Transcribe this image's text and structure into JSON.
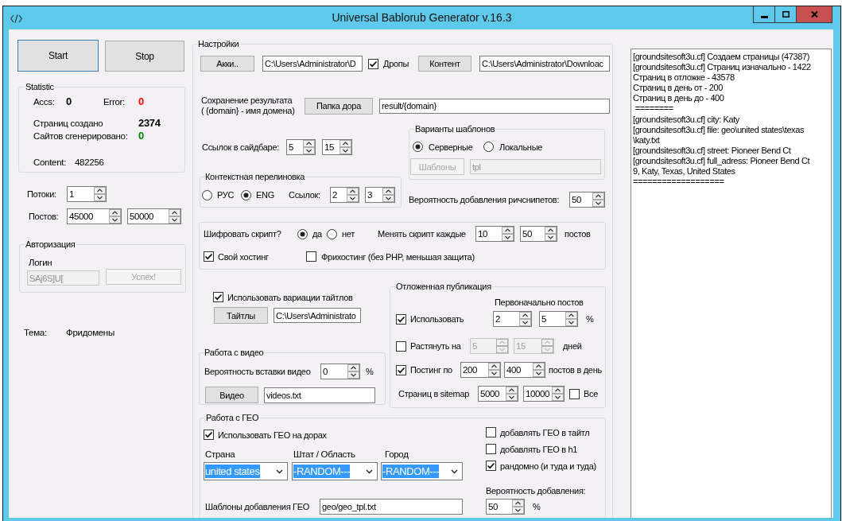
{
  "window": {
    "title": "Universal Bablorub Generator v.16.3"
  },
  "actions": [
    {
      "label": "Start",
      "focused": true
    },
    {
      "label": "Stop",
      "focused": false
    }
  ],
  "statistic": {
    "title": "Statistic",
    "rows": [
      [
        {
          "label": "Accs:",
          "value": "0",
          "color": "#000000"
        },
        {
          "label": "Error:",
          "value": "0",
          "color": "#ff0000"
        }
      ],
      [
        {
          "label": "Страниц создано",
          "value": "2374",
          "color": "#000000"
        }
      ],
      [
        {
          "label": "Сайтов сгенерировано:",
          "value": "0",
          "color": "#008000"
        }
      ]
    ],
    "content": {
      "label": "Content:",
      "value": "482256"
    }
  },
  "threads": {
    "label": "Потоки:",
    "value": "1"
  },
  "posts": {
    "label": "Постов:",
    "from": "45000",
    "to": "50000"
  },
  "authorization": {
    "title": "Авторизация",
    "login_label": "Логин",
    "login": "SAj6S]U[",
    "button": "Успех!",
    "disabled": true
  },
  "theme": {
    "label": "Тема:",
    "value": "Фридомены"
  },
  "settings": {
    "title": "Настройки",
    "accounts": {
      "button": "Акки..",
      "path": "C:\\Users\\Administrator\\D"
    },
    "drops": {
      "label": "Дропы",
      "checked": true
    },
    "content": {
      "button": "Контент",
      "path": "C:\\Users\\Administrator\\Downloac"
    },
    "output": {
      "label": "Сохранение результата\n( {domain} - имя домена)",
      "button": "Папка дора",
      "path": "result/{domain}"
    },
    "sidebar_links": {
      "label": "Ссылок в сайдбаре:",
      "from": "5",
      "to": "15"
    },
    "templates": {
      "title": "Варианты шаблонов",
      "options": [
        {
          "label": "Серверные",
          "selected": true
        },
        {
          "label": "Локальные",
          "selected": false
        }
      ],
      "button": "Шаблоны",
      "path": "tpl",
      "disabled": true
    },
    "context_links": {
      "title": "Контекстная перелиновка",
      "options": [
        {
          "label": "РУС",
          "selected": false
        },
        {
          "label": "ENG",
          "selected": true
        }
      ],
      "count_label": "Ссылок:",
      "from": "2",
      "to": "3"
    },
    "rich_snippets": {
      "label": "Вероятность добавления ричснипетов:",
      "value": "50"
    },
    "script": {
      "label": "Шифровать скрипт?",
      "options": [
        {
          "label": "да",
          "selected": true
        },
        {
          "label": "нет",
          "selected": false
        }
      ],
      "change_label": "Менять скрипт каждые",
      "from": "10",
      "to": "50",
      "unit": "постов",
      "hosting": [
        {
          "label": "Свой хостинг",
          "checked": true
        },
        {
          "label": "Фрихостинг (без PHP, меньшая защита)",
          "checked": false
        }
      ]
    },
    "titles": {
      "label": "Использовать вариации тайтлов",
      "checked": true,
      "button": "Тайтлы",
      "path": "C:\\Users\\Administrato"
    },
    "video": {
      "title": "Работа с видео",
      "label": "Вероятность вставки видео",
      "value": "0",
      "unit": "%",
      "button": "Видео",
      "file": "videos.txt"
    },
    "delayed": {
      "title": "Отложенная публикация",
      "header": "Первоначально постов",
      "rows": [
        {
          "label": "Использовать",
          "checked": true,
          "from": "2",
          "to": "5",
          "unit": "%",
          "disabled": false
        },
        {
          "label": "Растянуть на",
          "checked": false,
          "from": "5",
          "to": "15",
          "unit": "дней",
          "disabled": true
        },
        {
          "label": "Постинг по",
          "checked": true,
          "from": "200",
          "to": "400",
          "unit": "постов в день",
          "disabled": false
        }
      ],
      "sitemap": {
        "label": "Страниц в sitemap",
        "from": "5000",
        "to": "10000",
        "all_label": "Все",
        "all_checked": false
      }
    },
    "geo": {
      "title": "Работа с ГЕО",
      "use_label": "Использовать ГЕО на дорах",
      "use_checked": true,
      "selects": [
        {
          "label": "Страна",
          "value": "united states",
          "highlighted": true
        },
        {
          "label": "Штат / Область",
          "value": "-RANDOM---",
          "highlighted": true
        },
        {
          "label": "Город",
          "value": "-RANDOM---",
          "highlighted": true
        }
      ],
      "templates_label": "Шаблоны добавления ГЕО",
      "templates": "geo/geo_tpl.txt",
      "options": [
        {
          "label": "добавлять ГЕО в тайтл",
          "checked": false
        },
        {
          "label": "добавлять ГЕО в h1",
          "checked": false
        },
        {
          "label": "рандомно (и туда и туда)",
          "checked": true
        }
      ],
      "probability_label": "Вероятность добавления:",
      "probability": "50",
      "unit": "%"
    }
  },
  "log": {
    "lines": [
      "[groundsitesoft3u.cf] Создаем страницы (47387)",
      "[groundsitesoft3u.cf] Страниц изначально - 1422",
      "Страниц в отложке - 43578",
      "Страниц в день от - 200",
      "Страниц в день до - 400",
      " ========",
      "[groundsitesoft3u.cf] city: Katy",
      "[groundsitesoft3u.cf] file: geo\\united states\\texas",
      "\\katy.txt",
      "[groundsitesoft3u.cf] street: Pioneer Bend Ct",
      "[groundsitesoft3u.cf] full_adress: Pioneer Bend Ct",
      "9, Katy, Texas, United States",
      "==================="
    ]
  }
}
